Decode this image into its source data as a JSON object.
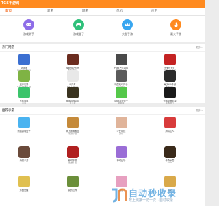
{
  "site": {
    "logo": "TGS手游网"
  },
  "nav": {
    "tabs": [
      "首页",
      "新游",
      "网游",
      "单机",
      "应用"
    ],
    "active_index": 0
  },
  "categories": [
    {
      "label": "游戏助手",
      "color": "#8e6de8",
      "icon": "gamepad-icon"
    },
    {
      "label": "游戏盒子",
      "color": "#2fc07a",
      "icon": "controller-icon"
    },
    {
      "label": "大型手游",
      "color": "#38a6f0",
      "icon": "crown-icon"
    },
    {
      "label": "最火手游",
      "color": "#ff8a1f",
      "icon": "flame-icon"
    }
  ],
  "hot_section": {
    "title": "热门网游",
    "more": "更多 >",
    "apps": [
      {
        "name": "Mobile",
        "name2": "Legends:Bang",
        "color": "#3b6fd1"
      },
      {
        "name": "传奇战记击杀",
        "name2": "游戏(图片)",
        "color": "#6b2c1f"
      },
      {
        "name": "Pubg™手游最",
        "name2": "新版本下载",
        "color": "#4a4a4a"
      },
      {
        "name": "光荣改皮打",
        "name2": "光荣打斗手游",
        "color": "#c42222"
      },
      {
        "name": "迷你世界",
        "name2": "0.42.3版本下载",
        "color": "#7fb344"
      },
      {
        "name": "M传奇",
        "name2": "M版下载app",
        "color": "#e8e8e8"
      },
      {
        "name": "暗黑破坏神手",
        "name2": "游戏排名",
        "color": "#5b5b5b"
      },
      {
        "name": "每秒100手游",
        "name2": "游戏盒子",
        "color": "#2b2b2b"
      },
      {
        "name": "宝石连连",
        "name2": "手游",
        "color": "#3bc46b"
      },
      {
        "name": "极限游戏中平",
        "name2": "台下载",
        "color": "#3a3320"
      },
      {
        "name": "4399游戏盒子",
        "name2": "最新版",
        "color": "#55c84a"
      },
      {
        "name": "无限极速手游",
        "name2": "手游排行",
        "color": "#1a1a1a"
      }
    ]
  },
  "rec_section": {
    "title": "推荐手游",
    "more": "更多 >",
    "apps": [
      {
        "name": "熊猫游戏盒子",
        "name2": "",
        "color": "#4ab3f0"
      },
      {
        "name": "掌上道明宝盒",
        "name2": "手游下载",
        "color": "#c58a3a"
      },
      {
        "name": "少女前线",
        "name2": "游戏",
        "color": "#e0b49a"
      },
      {
        "name": "麻将达人",
        "name2": "",
        "color": "#d83b3b"
      },
      {
        "name": "海棠手游",
        "name2": "",
        "color": "#6a4a3a"
      },
      {
        "name": "魔域手游",
        "name2": "奇迹下载",
        "color": "#b02020"
      },
      {
        "name": "神域战场",
        "name2": "",
        "color": "#9a6dd6"
      },
      {
        "name": "传奇冰雪",
        "name2": "2022",
        "color": "#3a2a1a"
      },
      {
        "name": "万国觉醒",
        "name2": "",
        "color": "#e0c050"
      },
      {
        "name": "我的世界",
        "name2": "",
        "color": "#6b8f3a"
      },
      {
        "name": "忘仙",
        "name2": "",
        "color": "#e7a0c0"
      },
      {
        "name": "烧烤",
        "name2": "",
        "color": "#d9a94a"
      }
    ]
  },
  "watermark": {
    "line1": "自动秒收录",
    "line2": "数上链接一访一次→自动收录"
  }
}
